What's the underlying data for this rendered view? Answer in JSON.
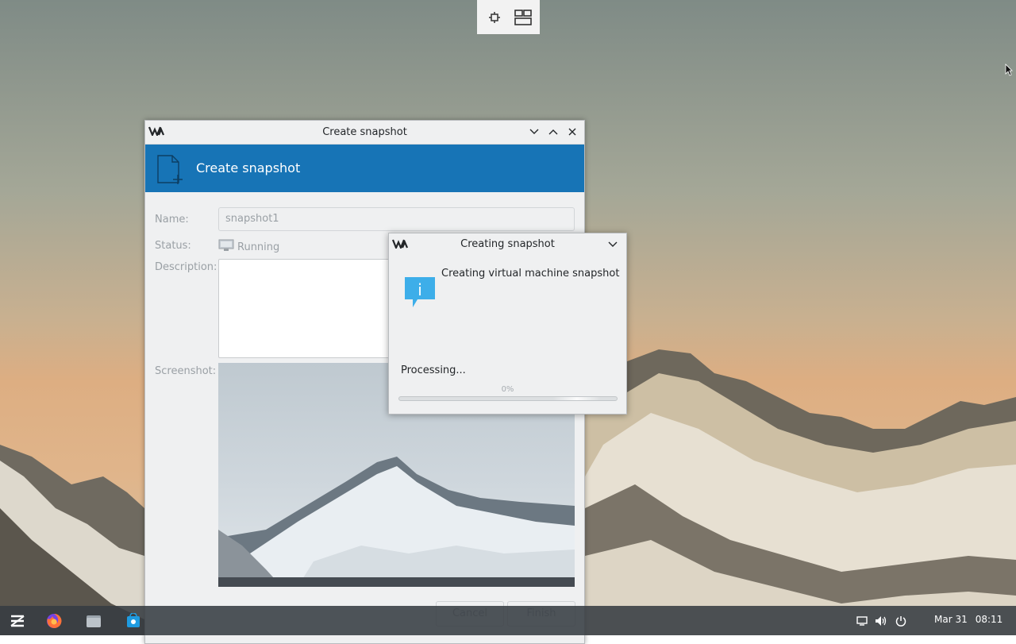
{
  "vm_toolbar": {
    "icons": [
      "fit-screen-icon",
      "window-layout-icon"
    ]
  },
  "dialog": {
    "title": "Create snapshot",
    "header_title": "Create snapshot",
    "labels": {
      "name": "Name:",
      "status": "Status:",
      "description": "Description:",
      "screenshot": "Screenshot:"
    },
    "name_value": "snapshot1",
    "status_value": "Running",
    "buttons": {
      "cancel": "Cancel",
      "finish": "Finish"
    }
  },
  "progress_popup": {
    "title": "Creating snapshot",
    "message": "Creating virtual machine snapshot",
    "status": "Processing...",
    "percent_label": "0%",
    "progress": 0
  },
  "taskbar": {
    "apps": [
      "zorin-menu-icon",
      "firefox-icon",
      "files-icon",
      "software-store-icon"
    ],
    "tray": [
      "display-icon",
      "volume-icon",
      "power-icon"
    ],
    "date": "Mar 31",
    "time": "08:11"
  },
  "colors": {
    "header_blue": "#1774b6",
    "progress_blue": "#3daee9"
  }
}
